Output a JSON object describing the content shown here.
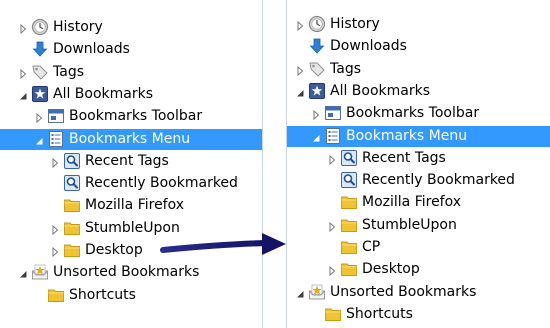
{
  "left_tree": {
    "items": [
      {
        "label": "History",
        "icon": "history-clock-icon",
        "level": 0,
        "expander": "collapsed"
      },
      {
        "label": "Downloads",
        "icon": "download-arrow-icon",
        "level": 0,
        "expander": "none"
      },
      {
        "label": "Tags",
        "icon": "tag-icon",
        "level": 0,
        "expander": "collapsed"
      },
      {
        "label": "All Bookmarks",
        "icon": "star-bookmark-icon",
        "level": 0,
        "expander": "expanded"
      },
      {
        "label": "Bookmarks Toolbar",
        "icon": "toolbar-icon",
        "level": 1,
        "expander": "collapsed"
      },
      {
        "label": "Bookmarks Menu",
        "icon": "menu-list-icon",
        "level": 1,
        "expander": "expanded",
        "selected": true
      },
      {
        "label": "Recent Tags",
        "icon": "smart-folder-search-icon",
        "level": 2,
        "expander": "collapsed"
      },
      {
        "label": "Recently Bookmarked",
        "icon": "smart-folder-search-icon",
        "level": 2,
        "expander": "none"
      },
      {
        "label": "Mozilla Firefox",
        "icon": "folder-icon",
        "level": 2,
        "expander": "none"
      },
      {
        "label": "StumbleUpon",
        "icon": "folder-icon",
        "level": 2,
        "expander": "collapsed"
      },
      {
        "label": "Desktop",
        "icon": "folder-icon",
        "level": 2,
        "expander": "collapsed"
      },
      {
        "label": "Unsorted Bookmarks",
        "icon": "unsorted-bookmarks-icon",
        "level": 0,
        "expander": "expanded"
      },
      {
        "label": "Shortcuts",
        "icon": "folder-icon",
        "level": 1,
        "expander": "none"
      }
    ]
  },
  "right_tree": {
    "items": [
      {
        "label": "History",
        "icon": "history-clock-icon",
        "level": 0,
        "expander": "collapsed"
      },
      {
        "label": "Downloads",
        "icon": "download-arrow-icon",
        "level": 0,
        "expander": "none"
      },
      {
        "label": "Tags",
        "icon": "tag-icon",
        "level": 0,
        "expander": "collapsed"
      },
      {
        "label": "All Bookmarks",
        "icon": "star-bookmark-icon",
        "level": 0,
        "expander": "expanded"
      },
      {
        "label": "Bookmarks Toolbar",
        "icon": "toolbar-icon",
        "level": 1,
        "expander": "collapsed"
      },
      {
        "label": "Bookmarks Menu",
        "icon": "menu-list-icon",
        "level": 1,
        "expander": "expanded",
        "selected": true
      },
      {
        "label": "Recent Tags",
        "icon": "smart-folder-search-icon",
        "level": 2,
        "expander": "collapsed"
      },
      {
        "label": "Recently Bookmarked",
        "icon": "smart-folder-search-icon",
        "level": 2,
        "expander": "none"
      },
      {
        "label": "Mozilla Firefox",
        "icon": "folder-icon",
        "level": 2,
        "expander": "none"
      },
      {
        "label": "StumbleUpon",
        "icon": "folder-icon",
        "level": 2,
        "expander": "collapsed"
      },
      {
        "label": "CP",
        "icon": "folder-icon",
        "level": 2,
        "expander": "none"
      },
      {
        "label": "Desktop",
        "icon": "folder-icon",
        "level": 2,
        "expander": "collapsed"
      },
      {
        "label": "Unsorted Bookmarks",
        "icon": "unsorted-bookmarks-icon",
        "level": 0,
        "expander": "expanded"
      },
      {
        "label": "Shortcuts",
        "icon": "folder-icon",
        "level": 1,
        "expander": "none"
      }
    ]
  },
  "annotation": {
    "icon": "navy-arrow-icon",
    "color": "#1a1a7a"
  },
  "colors": {
    "selection": "#3399ff",
    "folder": "#f0c330",
    "expander": "#7a7a7a",
    "download": "#2e7fd6"
  }
}
